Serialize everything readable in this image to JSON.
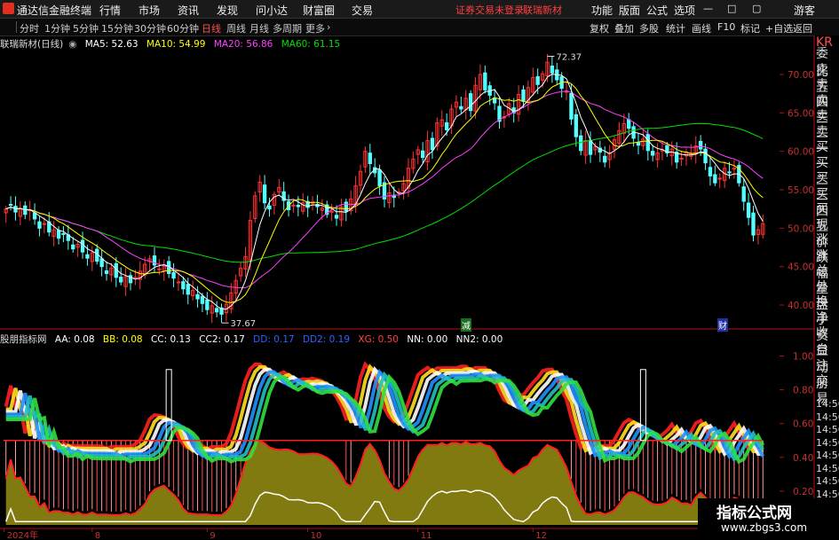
{
  "app": {
    "title": "通达信金融终端",
    "menu": [
      "行情",
      "市场",
      "资讯",
      "发现",
      "问小达",
      "财富圈",
      "交易"
    ],
    "login_notice": "证券交易未登录",
    "stock_notice": "联瑞新材",
    "right_menu": [
      "功能",
      "版面",
      "公式",
      "选项"
    ],
    "guest": "游客"
  },
  "periods": {
    "tabs": [
      "分时",
      "1分钟",
      "5分钟",
      "15分钟",
      "30分钟",
      "60分钟",
      "日线",
      "周线",
      "月线",
      "多周期",
      "更多"
    ],
    "active": "日线",
    "right_tabs": [
      "复权",
      "叠加",
      "多股",
      "统计",
      "画线",
      "F10",
      "标记",
      "+自选",
      "返回"
    ]
  },
  "main_info": {
    "stock": "联瑞新材(日线)",
    "ma5": "MA5: 52.63",
    "ma10": "MA10: 54.99",
    "ma20": "MA20: 56.86",
    "ma60": "MA60: 61.15",
    "high_label": "72.37",
    "low_label": "37.67",
    "badge1": "减",
    "badge2": "财"
  },
  "indicator_info": {
    "name": "股朋指标网",
    "aa": "AA: 0.08",
    "bb": "BB: 0.08",
    "cc": "CC: 0.13",
    "cc2": "CC2: 0.17",
    "dd": "DD: 0.17",
    "dd2": "DD2: 0.19",
    "xg": "XG: 0.50",
    "nn": "NN: 0.00",
    "nn2": "NN2: 0.00"
  },
  "price_axis": [
    "70.00",
    "65.00",
    "60.00",
    "55.00",
    "50.00",
    "45.00",
    "40.00"
  ],
  "ind_axis": [
    "1.00",
    "0.80",
    "0.60",
    "0.40",
    "0.20"
  ],
  "date_axis": [
    "2024年",
    "8",
    "9",
    "10",
    "11",
    "12",
    "2",
    "3"
  ],
  "right_panel": {
    "top_badge": "KR",
    "items_upper": [
      "委比",
      "卖五",
      "卖四",
      "卖三",
      "卖二",
      "卖一",
      "买一",
      "买二",
      "买三",
      "买四",
      "买五",
      "现价",
      "涨跌",
      "涨幅",
      "总量",
      "外盘",
      "换手",
      "净资",
      "收益"
    ],
    "items_lower": [
      "自动",
      "注册",
      "交易"
    ],
    "times": [
      "14:56",
      "14:56",
      "14:56",
      "14:56",
      "14:56",
      "14:56",
      "14:56",
      "14:56"
    ]
  },
  "watermark": {
    "title": "指标公式网",
    "url": "www.zbgs3.com"
  },
  "colors": {
    "up": "#ff3232",
    "down": "#54ffff",
    "ma5": "#ffffff",
    "ma10": "#ffff00",
    "ma20": "#ff40ff",
    "ma60": "#00e000",
    "axis_red": "#b01010"
  },
  "chart_data": {
    "type": "candlestick",
    "price_ylim": [
      37,
      73
    ],
    "indicator_ylim": [
      0,
      1.05
    ],
    "closes": [
      52.5,
      53.0,
      52.1,
      52.6,
      51.8,
      52.4,
      51.2,
      50.0,
      50.6,
      49.5,
      49.8,
      48.7,
      49.2,
      48.4,
      47.3,
      47.9,
      46.9,
      46.1,
      46.8,
      45.7,
      45.0,
      44.1,
      44.8,
      43.6,
      43.0,
      43.7,
      42.9,
      43.6,
      44.4,
      45.3,
      46.0,
      45.2,
      44.7,
      45.1,
      44.1,
      43.5,
      43.0,
      42.1,
      41.4,
      41.9,
      40.8,
      40.2,
      39.4,
      39.9,
      39.1,
      38.8,
      40.1,
      41.6,
      43.2,
      44.8,
      46.3,
      51.0,
      54.2,
      56.0,
      53.3,
      52.5,
      54.4,
      55.3,
      53.6,
      52.4,
      53.0,
      52.8,
      53.3,
      52.7,
      53.4,
      52.8,
      52.6,
      51.8,
      52.2,
      51.3,
      52.8,
      52.2,
      53.8,
      55.5,
      57.4,
      60.0,
      58.4,
      57.2,
      55.5,
      53.8,
      54.6,
      54.0,
      54.7,
      55.8,
      57.8,
      59.0,
      60.2,
      59.2,
      61.4,
      60.2,
      63.7,
      64.1,
      62.8,
      65.5,
      66.4,
      65.5,
      66.9,
      65.3,
      68.6,
      70.0,
      68.0,
      67.3,
      66.3,
      63.9,
      64.5,
      66.2,
      65.0,
      67.4,
      66.5,
      68.3,
      69.6,
      68.7,
      70.1,
      71.6,
      70.2,
      69.3,
      68.2,
      67.8,
      64.2,
      61.9,
      60.1,
      61.4,
      59.6,
      60.6,
      59.9,
      58.6,
      59.8,
      61.5,
      62.7,
      63.6,
      63.0,
      61.7,
      60.8,
      61.6,
      60.1,
      59.5,
      59.8,
      60.2,
      59.8,
      60.3,
      58.6,
      59.1,
      59.9,
      59.8,
      60.7,
      60.3,
      58.5,
      56.8,
      55.9,
      56.5,
      57.8,
      57.3,
      57.8,
      55.9,
      53.5,
      51.4,
      49.1,
      49.8,
      50.6
    ],
    "ma5_last": 52.63,
    "ma10_last": 54.99,
    "ma20_last": 56.86,
    "ma60_last": 61.15,
    "high": 72.37,
    "low": 37.67,
    "indicator": {
      "AA": 0.08,
      "BB": 0.08,
      "CC": 0.13,
      "CC2": 0.17,
      "DD": 0.17,
      "DD2": 0.19,
      "XG": 0.5,
      "NN": 0.0,
      "NN2": 0.0
    },
    "xlabels": [
      "2024年",
      "8",
      "9",
      "10",
      "11",
      "12",
      "2",
      "3"
    ]
  }
}
